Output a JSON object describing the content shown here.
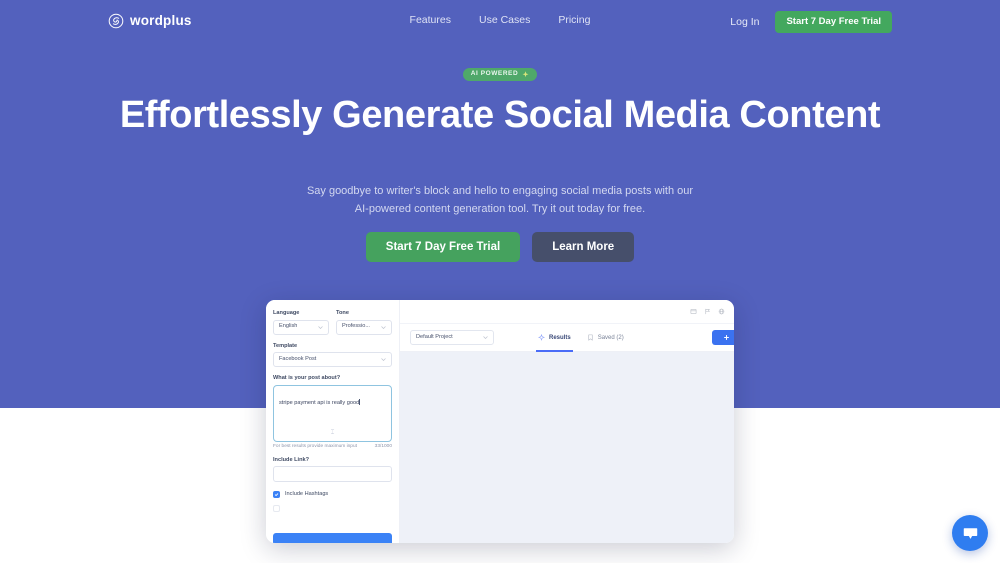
{
  "nav": {
    "logo_text": "wordplus",
    "logo_icon": "spiral-swirl-icon",
    "links": [
      {
        "label": "Features"
      },
      {
        "label": "Use Cases"
      },
      {
        "label": "Pricing"
      }
    ],
    "login_label": "Log In",
    "trial_label": "Start 7 Day Free Trial"
  },
  "hero": {
    "badge_text": "AI POWERED",
    "badge_icon": "sparkle-icon",
    "title": "Effortlessly Generate Social Media Content",
    "subtitle": "Say goodbye to writer's block and hello to engaging social media posts with our AI-powered content generation tool. Try it out today for free.",
    "cta_primary": "Start 7 Day Free Trial",
    "cta_secondary": "Learn More"
  },
  "app": {
    "sidebar": {
      "language_label": "Language",
      "language_value": "English",
      "tone_label": "Tone",
      "tone_value": "Professio...",
      "template_label": "Template",
      "template_value": "Facebook Post",
      "prompt_label": "What is your post about?",
      "prompt_value": "stripe payment api is really good",
      "hint_text": "For best results provide maximum input",
      "char_count": "33/1000",
      "link_label": "Include Link?",
      "link_value": "",
      "hashtags_label": "Include Hashtags",
      "generate_label": ""
    },
    "main": {
      "project_value": "Default Project",
      "tabs": [
        {
          "label": "Results",
          "icon": "sparkle-icon",
          "active": true
        },
        {
          "label": "Saved (2)",
          "icon": "bookmark-icon",
          "active": false
        }
      ],
      "add_label": "+",
      "topbar_icons": [
        "grid-icon",
        "flag-icon",
        "globe-icon"
      ]
    }
  },
  "chat": {
    "icon": "chat-bubble-icon"
  },
  "colors": {
    "hero_bg": "#5361bd",
    "green_accent": "#45a25e",
    "blue_accent": "#3b72f6",
    "dark_button": "#464f6b"
  }
}
